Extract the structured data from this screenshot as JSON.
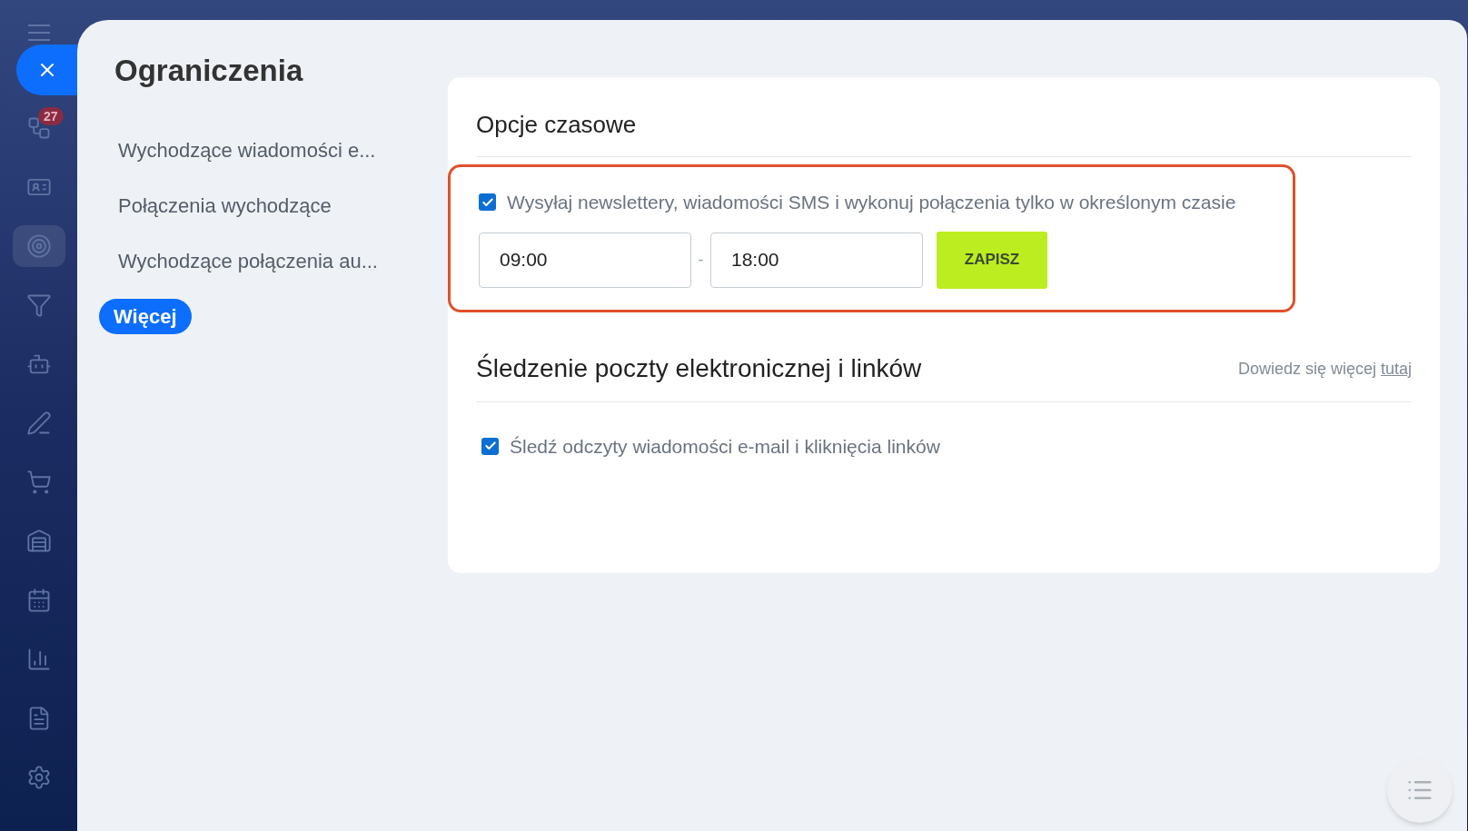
{
  "sidebar": {
    "badge": "27",
    "items": [
      {
        "kind": "menu",
        "selected": false
      },
      {
        "kind": "deals",
        "selected": false
      },
      {
        "kind": "contacts",
        "selected": false
      },
      {
        "kind": "target",
        "selected": true
      },
      {
        "kind": "funnel",
        "selected": false
      },
      {
        "kind": "robot",
        "selected": false
      },
      {
        "kind": "pen",
        "selected": false
      },
      {
        "kind": "cart",
        "selected": false
      },
      {
        "kind": "store",
        "selected": false
      },
      {
        "kind": "calendar",
        "selected": false
      },
      {
        "kind": "chart",
        "selected": false
      },
      {
        "kind": "doc",
        "selected": false
      },
      {
        "kind": "gear",
        "selected": false
      }
    ]
  },
  "page": {
    "title": "Ograniczenia"
  },
  "nav": [
    {
      "label": "Wychodzące wiadomości e...",
      "selected": false
    },
    {
      "label": "Połączenia wychodzące",
      "selected": false
    },
    {
      "label": "Wychodzące połączenia au...",
      "selected": false
    },
    {
      "label": "Więcej",
      "selected": true
    }
  ],
  "time_options": {
    "title": "Opcje czasowe",
    "checkbox": {
      "label": "Wysyłaj newslettery, wiadomości SMS i wykonuj połączenia tylko w określonym czasie",
      "checked": true
    },
    "from": "09:00",
    "separator": "-",
    "to": "18:00",
    "save_button": "ZAPISZ"
  },
  "tracking": {
    "title": "Śledzenie poczty elektronicznej i linków",
    "hint": "Dowiedz się więcej",
    "link": "tutaj",
    "checkbox": {
      "label": "Śledź odczyty wiadomości e-mail i kliknięcia linków",
      "checked": true
    }
  }
}
